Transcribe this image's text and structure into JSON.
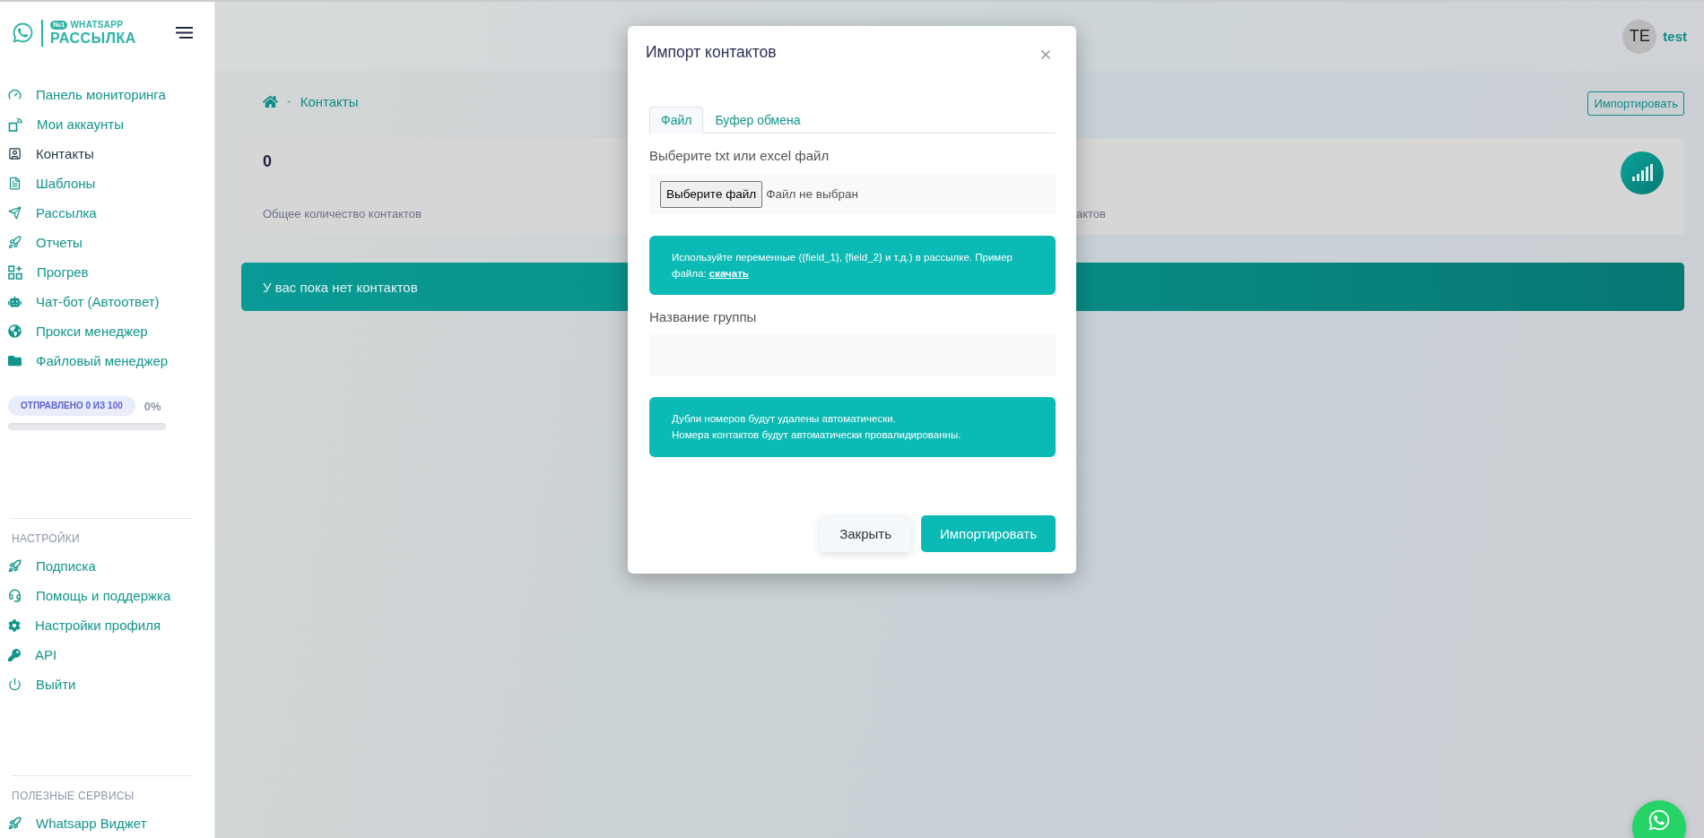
{
  "sidebar": {
    "logo": {
      "badge": "№1",
      "title": "WHATSAPP",
      "subtitle": "РАССЫЛКА"
    },
    "menu": [
      {
        "label": "Панель мониторинга",
        "selected": false
      },
      {
        "label": "Мои аккаунты",
        "selected": false
      },
      {
        "label": "Контакты",
        "selected": true
      },
      {
        "label": "Шаблоны",
        "selected": false
      },
      {
        "label": "Рассылка",
        "selected": false
      },
      {
        "label": "Отчеты",
        "selected": false
      },
      {
        "label": "Прогрев",
        "selected": false
      },
      {
        "label": "Чат-бот (Автоответ)",
        "selected": false
      },
      {
        "label": "Прокси менеджер",
        "selected": false
      },
      {
        "label": "Файловый менеджер",
        "selected": false
      }
    ],
    "usage": {
      "badge": "ОТПРАВЛЕНО 0 ИЗ 100",
      "percent": "0%",
      "level": 0
    },
    "sections": [
      {
        "title": "НАСТРОЙКИ",
        "items": [
          {
            "label": "Подписка",
            "selected": false
          },
          {
            "label": "Помощь и поддержка",
            "selected": false
          },
          {
            "label": "Настройки профиля",
            "selected": false
          },
          {
            "label": "API",
            "selected": false
          },
          {
            "label": "Выйти",
            "selected": false
          }
        ]
      },
      {
        "title": "ПОЛЕЗНЫЕ СЕРВИСЫ",
        "items": [
          {
            "label": "Whatsapp Виджет",
            "selected": false
          }
        ]
      }
    ]
  },
  "header": {
    "avatar": "TE",
    "user": "test"
  },
  "breadcrumb": {
    "separator": "-",
    "current": "Контакты"
  },
  "import_button": "Импортировать",
  "stats_card": {
    "value": "0",
    "label": "Общее количество контактов",
    "label_2": "актов"
  },
  "notice": "У вас пока нет контактов",
  "dialog": {
    "title": "Импорт контактов",
    "tabs": [
      {
        "label": "Файл",
        "selected": true
      },
      {
        "label": "Буфер обмена",
        "selected": false
      }
    ],
    "file_label": "Выберите txt или excel файл",
    "file_button": "Выберите файл",
    "file_status": "Файл не выбран",
    "info": {
      "text": "Используйте переменные ({field_1}, {field_2} и т.д.) в рассылке. Пример файла:",
      "link": "скачать"
    },
    "group_label": "Название группы",
    "notes": [
      "Дубли номеров будут удалены автоматически.",
      "Номера контактов будут автоматически провалидированны."
    ],
    "buttons": [
      {
        "label": "Закрыть",
        "kind": "secondary"
      },
      {
        "label": "Импортировать",
        "kind": "primary"
      }
    ]
  }
}
